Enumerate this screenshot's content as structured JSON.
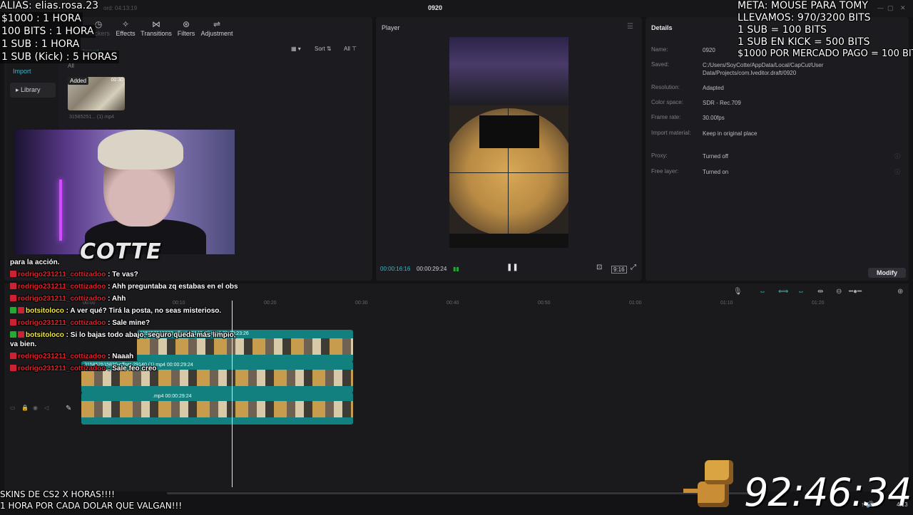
{
  "window": {
    "title": "0920",
    "record": "ord: 04:13:19"
  },
  "toolbar": {
    "items": [
      {
        "label": "Stickers",
        "icon": "sticker-icon",
        "dim": true
      },
      {
        "label": "Effects",
        "icon": "effects-icon"
      },
      {
        "label": "Transitions",
        "icon": "transitions-icon"
      },
      {
        "label": "Filters",
        "icon": "filters-icon"
      },
      {
        "label": "Adjustment",
        "icon": "adjustment-icon"
      }
    ]
  },
  "media": {
    "side": {
      "import": "Import",
      "library": "Library",
      "all": "All"
    },
    "sort": "Sort",
    "all": "All",
    "import_btn": "Import",
    "thumb": {
      "badge": "Added",
      "duration": "00:30",
      "name": "31585251... (1).mp4"
    }
  },
  "player": {
    "title": "Player",
    "current": "00:00:16:16",
    "total": "00:00:29:24",
    "ratio": "9:16"
  },
  "details": {
    "title": "Details",
    "rows": [
      {
        "k": "Name:",
        "v": "0920"
      },
      {
        "k": "Saved:",
        "v": "C:/Users/SoyCotte/AppData/Local/CapCut/User Data/Projects/com.lveditor.draft/0920"
      },
      {
        "k": "Resolution:",
        "v": "Adapted"
      },
      {
        "k": "Color space:",
        "v": "SDR - Rec.709"
      },
      {
        "k": "Frame rate:",
        "v": "30.00fps"
      },
      {
        "k": "Import material:",
        "v": "Keep in original place"
      },
      {
        "k": "Proxy:",
        "v": "Turned off"
      },
      {
        "k": "Free layer:",
        "v": "Turned on"
      }
    ],
    "modify": "Modify"
  },
  "timeline": {
    "ruler": [
      "00:00",
      "00:10",
      "00:20",
      "00:30",
      "00:40",
      "00:50",
      "01:00",
      "01:10",
      "01:20"
    ],
    "clips": [
      {
        "label": "31585251583​0-offset-29140 (1).mp4   00:00:23:26"
      },
      {
        "label": "31585251583​0-offset-29140 (1).mp4   00:00:29:24"
      },
      {
        "label": ".mp4   00:00:29:24"
      }
    ]
  },
  "overlay": {
    "topleft": [
      "ALIAS: elias.rosa.23",
      "$1000 : 1 HORA",
      "100 BITS : 1 HORA",
      "1 SUB : 1 HORA",
      "1 SUB (Kick) : 5 HORAS"
    ],
    "topright": [
      "META: MOUSE PARA TOMY",
      "LLEVAMOS: 970/3200 BITS",
      "1 SUB = 100 BITS",
      "1 SUB EN KICK = 500 BITS",
      "$1000 POR MERCADO PAGO = 100 BITS"
    ],
    "bottomleft": [
      "SKINS DE CS2 X HORAS!!!!",
      "1 HORA POR CADA DOLAR QUE VALGAN!!!"
    ],
    "timer": "92:46:34",
    "logo": "COTTE",
    "clock": "4:13"
  },
  "chat": {
    "messages": [
      {
        "text_only": "para la acción."
      },
      {
        "user": "rodrigo231211_cottizadoo",
        "msg": ": Te vas?",
        "bot": false
      },
      {
        "user": "rodrigo231211_cottizadoo",
        "msg": ": Ahh preguntaba zq estabas en el obs",
        "bot": false
      },
      {
        "user": "rodrigo231211_cottizadoo",
        "msg": ": Ahh",
        "bot": false
      },
      {
        "user": "botsitoloco",
        "msg": ": A ver qué? Tirá la posta, no seas misterioso.",
        "bot": true
      },
      {
        "user": "rodrigo231211_cottizadoo",
        "msg": ": Sale mine?",
        "bot": false
      },
      {
        "user": "botsitoloco",
        "msg": ": Si lo bajas todo abajo, seguro queda más limpio, va bien.",
        "bot": true
      },
      {
        "user": "rodrigo231211_cottizadoo",
        "msg": ": Naaah",
        "bot": false
      },
      {
        "user": "rodrigo231211_cottizadoo",
        "msg": ": Sale feo creo",
        "bot": false
      }
    ]
  }
}
